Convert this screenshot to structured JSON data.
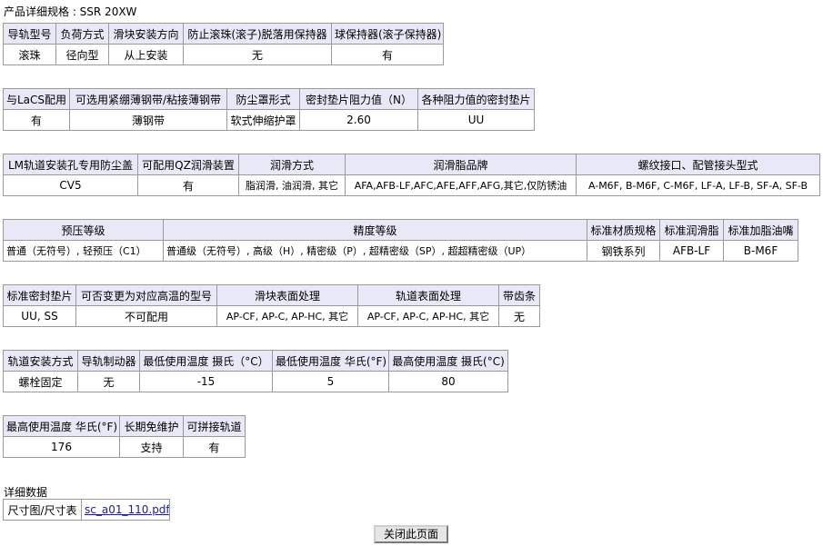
{
  "page_title": "产品详细规格 : SSR 20XW",
  "table1": {
    "headers": [
      "导轨型号",
      "负荷方式",
      "滑块安装方向",
      "防止滚珠(滚子)脱落用保持器",
      "球保持器(滚子保持器)"
    ],
    "values": [
      "滚珠",
      "径向型",
      "从上安装",
      "无",
      "有"
    ]
  },
  "table2": {
    "headers": [
      "与LaCS配用",
      "可选用紧绷薄钢带/粘接薄钢带",
      "防尘罩形式",
      "密封垫片阻力值（N）",
      "各种阻力值的密封垫片"
    ],
    "values": [
      "有",
      "薄钢带",
      "软式伸缩护罩",
      "2.60",
      "UU"
    ]
  },
  "table3": {
    "headers": [
      "LM轨道安装孔专用防尘盖",
      "可配用QZ润滑装置",
      "润滑方式",
      "润滑脂品牌",
      "螺纹接口、配管接头型式"
    ],
    "values": [
      "CV5",
      "有",
      "脂润滑, 油润滑, 其它",
      "AFA,AFB-LF,AFC,AFE,AFF,AFG,其它,仅防锈油",
      "A-M6F, B-M6F, C-M6F, LF-A, LF-B, SF-A, SF-B"
    ]
  },
  "table4": {
    "headers": [
      "预压等级",
      "精度等级",
      "标准材质规格",
      "标准润滑脂",
      "标准加脂油嘴"
    ],
    "values": [
      "普通（无符号）, 轻预压（C1）",
      "普通级（无符号）, 高级（H）, 精密级（P）, 超精密级（SP）, 超超精密级（UP）",
      "钢铁系列",
      "AFB-LF",
      "B-M6F"
    ]
  },
  "table5": {
    "headers": [
      "标准密封垫片",
      "可否变更为对应高温的型号",
      "滑块表面处理",
      "轨道表面处理",
      "带齿条"
    ],
    "values": [
      "UU, SS",
      "不可配用",
      "AP-CF, AP-C, AP-HC, 其它",
      "AP-CF, AP-C, AP-HC, 其它",
      "无"
    ]
  },
  "table6": {
    "headers": [
      "轨道安装方式",
      "导轨制动器",
      "最低使用温度 摄氏（°C）",
      "最低使用温度 华氏(°F)",
      "最高使用温度 摄氏(°C)"
    ],
    "values": [
      "螺栓固定",
      "无",
      "-15",
      "5",
      "80"
    ]
  },
  "table7": {
    "headers": [
      "最高使用温度 华氏(°F)",
      "长期免维护",
      "可拼接轨道"
    ],
    "values": [
      "176",
      "支持",
      "有"
    ]
  },
  "detail": {
    "label": "详细数据",
    "row_label": "尺寸图/尺寸表",
    "pdf_link": "sc_a01_110.pdf"
  },
  "close_button": "关闭此页面"
}
